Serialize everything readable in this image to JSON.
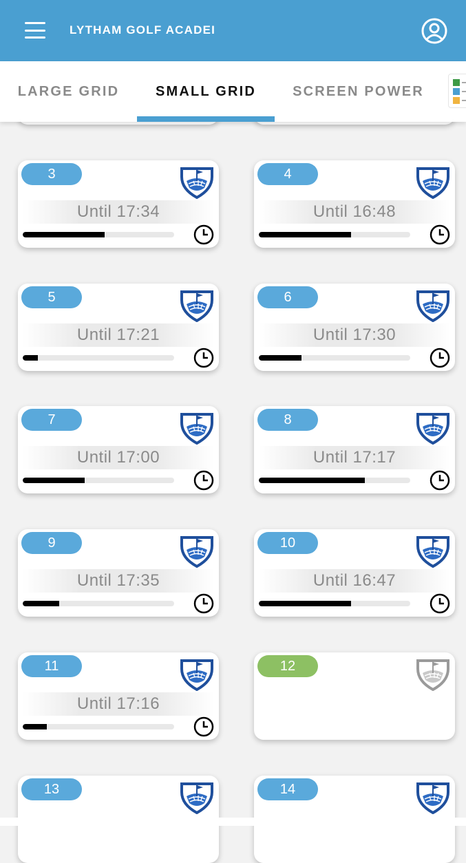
{
  "header": {
    "title": "LYTHAM GOLF ACADEI",
    "menu_icon": "hamburger-menu-icon",
    "profile_icon": "user-profile-icon",
    "color": "#4a9fd1"
  },
  "tabs": [
    {
      "label": "LARGE GRID",
      "active": false
    },
    {
      "label": "SMALL GRID",
      "active": true
    },
    {
      "label": "SCREEN POWER",
      "active": false
    }
  ],
  "colors": {
    "in_use_badge": "#5aa9db",
    "available_badge": "#8dc063",
    "progress": "#000000"
  },
  "bays": [
    {
      "number": "3",
      "status": "in-use",
      "until": "Until 17:34",
      "progress": 0.54
    },
    {
      "number": "4",
      "status": "in-use",
      "until": "Until 16:48",
      "progress": 0.61
    },
    {
      "number": "5",
      "status": "in-use",
      "until": "Until 17:21",
      "progress": 0.1
    },
    {
      "number": "6",
      "status": "in-use",
      "until": "Until 17:30",
      "progress": 0.28
    },
    {
      "number": "7",
      "status": "in-use",
      "until": "Until 17:00",
      "progress": 0.41
    },
    {
      "number": "8",
      "status": "in-use",
      "until": "Until 17:17",
      "progress": 0.7
    },
    {
      "number": "9",
      "status": "in-use",
      "until": "Until 17:35",
      "progress": 0.24
    },
    {
      "number": "10",
      "status": "in-use",
      "until": "Until 16:47",
      "progress": 0.61
    },
    {
      "number": "11",
      "status": "in-use",
      "until": "Until 17:16",
      "progress": 0.16
    },
    {
      "number": "12",
      "status": "available",
      "until": "",
      "progress": 0
    },
    {
      "number": "13",
      "status": "in-use",
      "until": "",
      "progress": 0
    },
    {
      "number": "14",
      "status": "in-use",
      "until": "",
      "progress": 0
    }
  ]
}
